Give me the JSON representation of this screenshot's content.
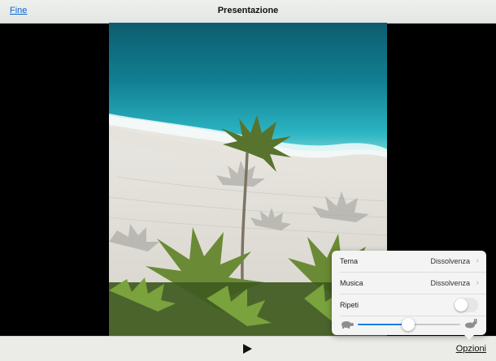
{
  "topbar": {
    "done_label": "Fine",
    "title": "Presentazione"
  },
  "photo": {
    "description_icon": "beach-palm-photo"
  },
  "bottombar": {
    "play_icon": "play-icon",
    "options_label": "Opzioni"
  },
  "options": {
    "rows": [
      {
        "label": "Tema",
        "value": "Dissolvenza"
      },
      {
        "label": "Musica",
        "value": "Dissolvenza"
      }
    ],
    "repeat_label": "Ripeti",
    "repeat_on": false,
    "speed_level": 0.49,
    "speed_slow_icon": "turtle-icon",
    "speed_fast_icon": "hare-icon"
  },
  "colors": {
    "link": "#0a63d6",
    "slider_fill": "#1a7ee6",
    "sea": "#1fa0b4",
    "sand": "#e9e6df"
  }
}
